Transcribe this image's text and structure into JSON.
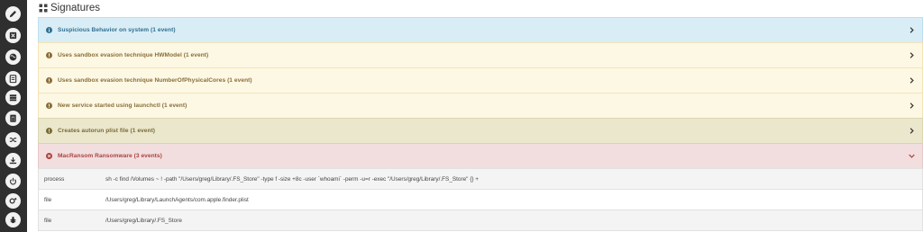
{
  "sidebar": {
    "icons": [
      {
        "name": "pencil-icon"
      },
      {
        "name": "document-icon"
      },
      {
        "name": "globe-icon"
      },
      {
        "name": "clipboard-icon"
      },
      {
        "name": "server-icon"
      },
      {
        "name": "calculator-icon"
      },
      {
        "name": "shuffle-icon"
      },
      {
        "name": "download-icon"
      },
      {
        "name": "power-icon"
      },
      {
        "name": "settings-icon"
      },
      {
        "name": "bug-icon"
      }
    ]
  },
  "section": {
    "title": "Signatures",
    "icon": "grid-icon"
  },
  "signatures": [
    {
      "label": "Suspicious Behavior on system (1 event)",
      "level": "info",
      "expanded": false
    },
    {
      "label": "Uses sandbox evasion technique HWModel (1 event)",
      "level": "warning",
      "expanded": false
    },
    {
      "label": "Uses sandbox evasion technique NumberOfPhysicalCores (1 event)",
      "level": "warning",
      "expanded": false
    },
    {
      "label": "New service started using launchctl (1 event)",
      "level": "warning",
      "expanded": false
    },
    {
      "label": "Creates autorun plist file (1 event)",
      "level": "olive",
      "expanded": false
    },
    {
      "label": "MacRansom Ransomware (3 events)",
      "level": "danger",
      "expanded": true
    }
  ],
  "details": [
    {
      "key": "process",
      "value": "sh -c find /Volumes ~ ! -path \"/Users/greg/Library/.FS_Store\" -type f -size +8c -user `whoami` -perm -u=r -exec \"/Users/greg/Library/.FS_Store\" {} +"
    },
    {
      "key": "file",
      "value": "/Users/greg/Library/LaunchAgents/com.apple.finder.plist"
    },
    {
      "key": "file",
      "value": "/Users/greg/Library/.FS_Store"
    }
  ]
}
